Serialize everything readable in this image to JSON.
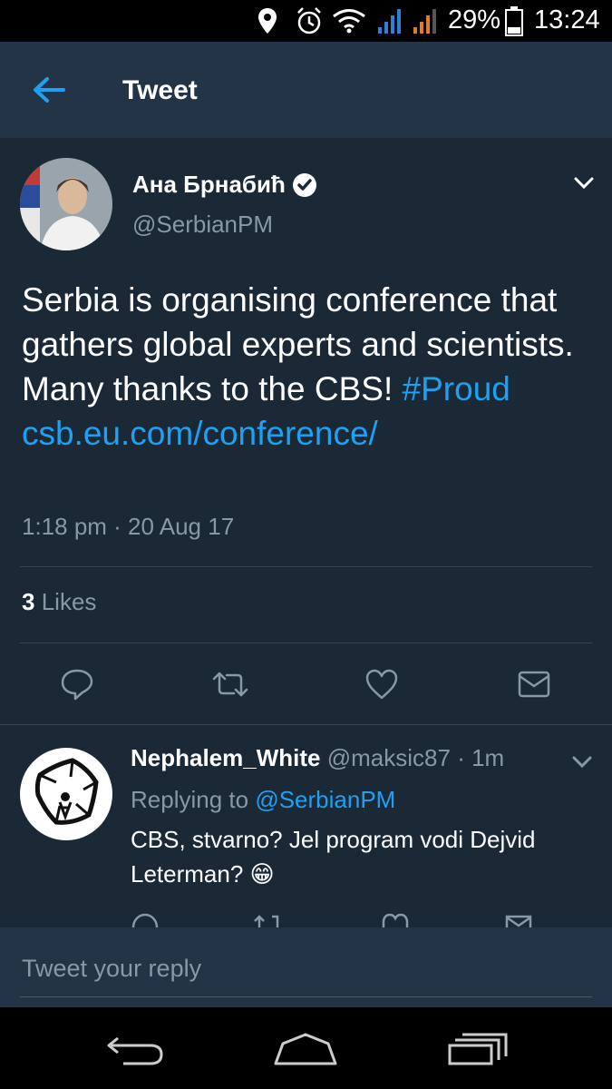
{
  "status_bar": {
    "battery": "29%",
    "time": "13:24",
    "icons": [
      "location-icon",
      "alarm-icon",
      "wifi-icon",
      "signal-icon",
      "signal-icon",
      "battery-icon"
    ]
  },
  "header": {
    "back_icon": "arrow-left-icon",
    "title": "Tweet"
  },
  "tweet": {
    "author_name": "Ана Брнабић",
    "handle": "@SerbianPM",
    "text_plain": "Serbia is organising conference that gathers global experts and scientists. Many thanks to the CBS!",
    "hashtag": "#Proud",
    "link": "csb.eu.com/conference/",
    "timestamp": "1:18 pm · 20 Aug 17",
    "likes_count": "3",
    "likes_label": "Likes",
    "actions": [
      "reply-icon",
      "retweet-icon",
      "like-icon",
      "message-icon"
    ]
  },
  "reply": {
    "author_name": "Nephalem_White",
    "handle": "@maksic87",
    "time": "· 1m",
    "replying_label": "Replying to",
    "replying_handle": "@SerbianPM",
    "text": "CBS, stvarno? Jel program vodi Dejvid Leterman?",
    "emoji": "😁"
  },
  "compose": {
    "placeholder": "Tweet your reply"
  },
  "colors": {
    "background": "#1b2836",
    "header": "#243447",
    "accent": "#1da1f2",
    "muted": "#8899a6"
  }
}
